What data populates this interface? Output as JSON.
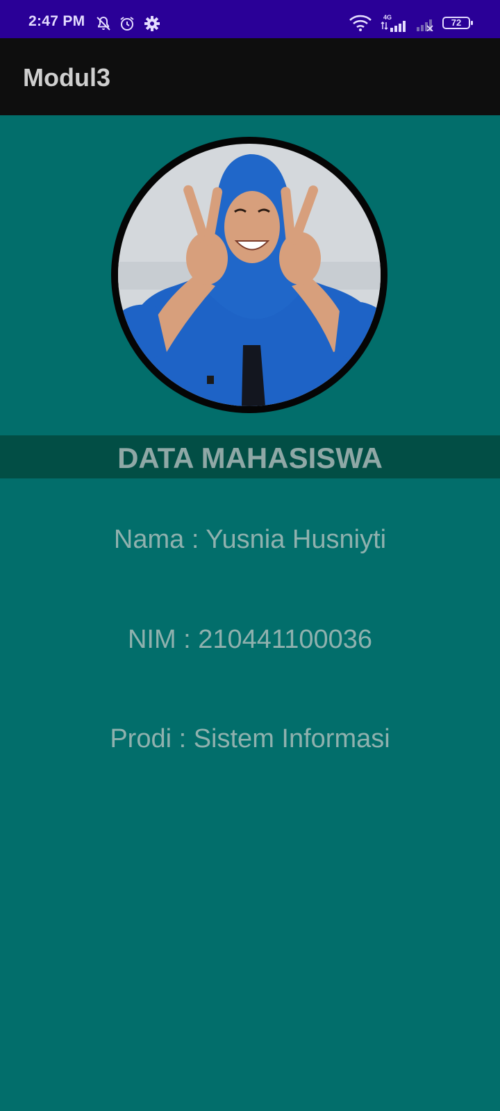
{
  "status_bar": {
    "time": "2:47 PM",
    "icons_left": [
      "notifications-off-icon",
      "alarm-icon",
      "settings-gear-icon"
    ],
    "icons_right": [
      "wifi-icon",
      "signal-4g-icon",
      "signal-no-service-icon"
    ],
    "network_label": "4G",
    "battery": "72"
  },
  "app_bar": {
    "title": "Modul3"
  },
  "profile": {
    "photo": "student-photo"
  },
  "section": {
    "header": "DATA MAHASISWA"
  },
  "details": {
    "nama": "Nama : Yusnia Husniyti",
    "nim": "NIM : 210441100036",
    "prodi": "Prodi : Sistem Informasi"
  },
  "colors": {
    "status_bar": "#2a0097",
    "app_bar": "#0e0e0e",
    "background": "#026e6b",
    "header_band": "#024e45"
  }
}
